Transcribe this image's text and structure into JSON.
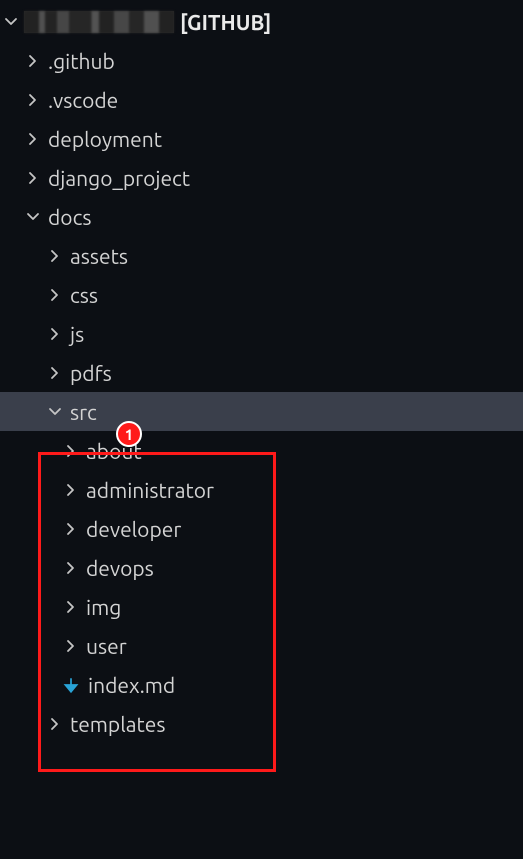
{
  "root": {
    "github_tag": "[GITHUB]"
  },
  "tree": {
    "github": ".github",
    "vscode": ".vscode",
    "deployment": "deployment",
    "django_project": "django_project",
    "docs": "docs",
    "docs_children": {
      "assets": "assets",
      "css": "css",
      "js": "js",
      "pdfs": "pdfs",
      "src": "src",
      "src_children": {
        "about": "about",
        "administrator": "administrator",
        "developer": "developer",
        "devops": "devops",
        "img": "img",
        "user": "user",
        "index_md": "index.md"
      },
      "templates": "templates"
    }
  },
  "callout": {
    "number": "1"
  }
}
